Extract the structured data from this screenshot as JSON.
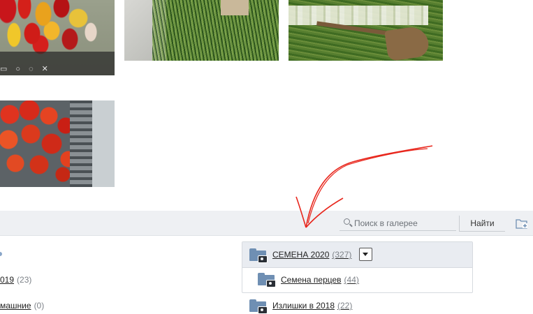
{
  "gallery": {
    "photos": [
      {
        "subject": "peppers"
      },
      {
        "subject": "garlic greens"
      },
      {
        "subject": "onions and shovel"
      },
      {
        "subject": "tomatoes in crate"
      }
    ]
  },
  "toolbar": {
    "search_placeholder": "Поиск в галерее",
    "find_label": "Найти"
  },
  "left_albums": [
    {
      "label": "019",
      "count": "(23)"
    },
    {
      "label": "машние",
      "count": "(0)"
    }
  ],
  "albums": {
    "current": {
      "label": "СЕМЕНА 2020",
      "count": "(327)"
    },
    "sub": {
      "label": "Семена перцев",
      "count": "(44)"
    },
    "next": {
      "label": "Излишки в 2018",
      "count": "(22)"
    }
  },
  "colors": {
    "toolbar_bg": "#eef0f3",
    "folder": "#6f8fb3",
    "annotation": "#e8261c"
  }
}
